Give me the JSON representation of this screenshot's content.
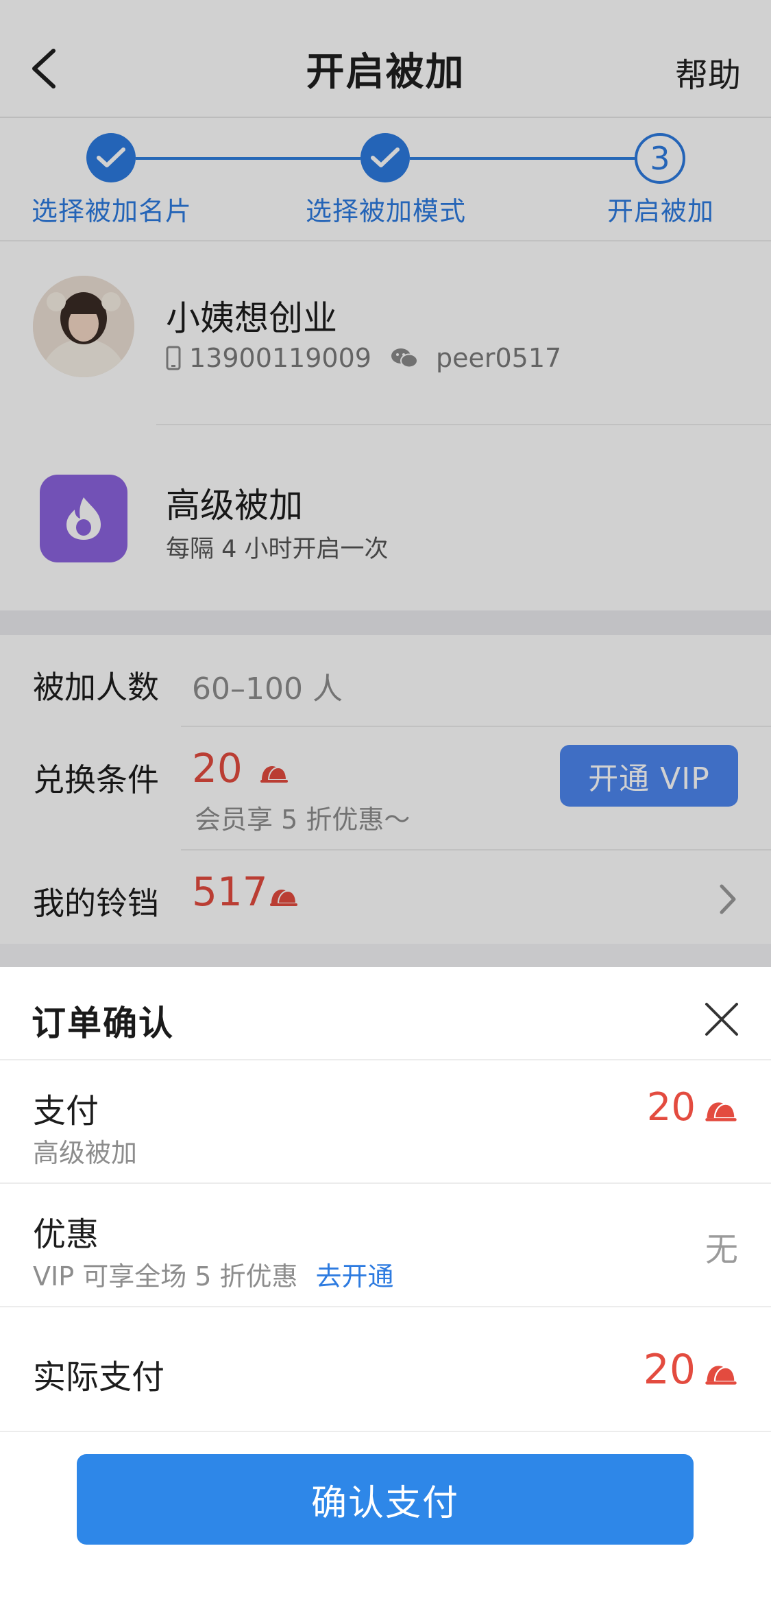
{
  "nav": {
    "title": "开启被加",
    "help": "帮助"
  },
  "stepper": {
    "steps": [
      {
        "label": "选择被加名片",
        "state": "done"
      },
      {
        "label": "选择被加模式",
        "state": "done"
      },
      {
        "label": "开启被加",
        "state": "current",
        "number": "3"
      }
    ]
  },
  "profile": {
    "name": "小姨想创业",
    "phone": "13900119009",
    "wechat": "peer0517"
  },
  "mode": {
    "title": "高级被加",
    "desc": "每隔 4 小时开启一次"
  },
  "info": {
    "count_label": "被加人数",
    "count_value": "60–100 人",
    "exchange_label": "兑换条件",
    "exchange_value": "20",
    "exchange_note": "会员享 5 折优惠～",
    "vip_button": "开通 VIP",
    "bells_label": "我的铃铛",
    "bells_value": "517"
  },
  "order": {
    "title": "订单确认",
    "pay_label": "支付",
    "pay_sub": "高级被加",
    "pay_amount": "20",
    "discount_label": "优惠",
    "discount_sub": "VIP 可享全场 5 折优惠",
    "discount_link": "去开通",
    "discount_value": "无",
    "actual_label": "实际支付",
    "actual_amount": "20",
    "confirm_button": "确认支付"
  },
  "colors": {
    "accent": "#2d7be0",
    "price": "#e34b3f",
    "mode_icon": "#8b63de",
    "vip_button": "#4d87f0"
  },
  "icons": {
    "back": "chevron-left-icon",
    "phone": "phone-icon",
    "wechat": "wechat-icon",
    "bell": "bell-icon",
    "close": "close-icon"
  }
}
